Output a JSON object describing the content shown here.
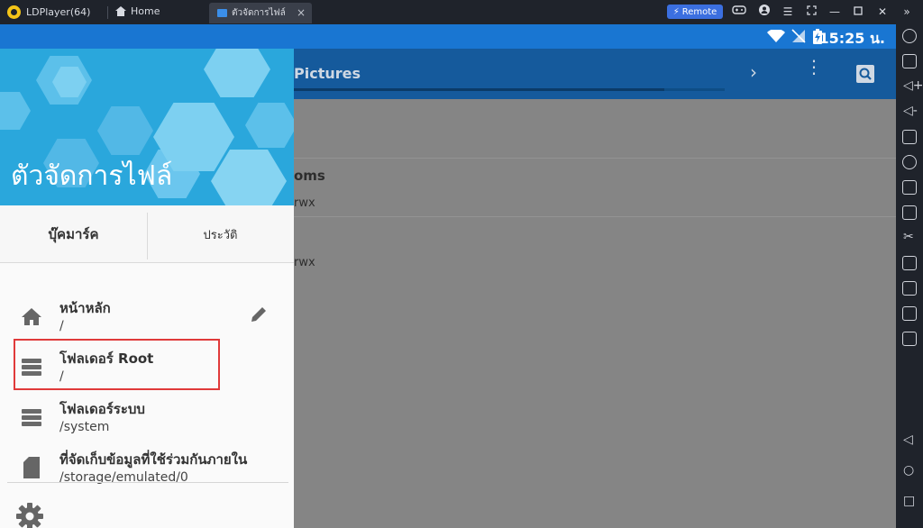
{
  "emulator": {
    "title": "LDPlayer(64)",
    "home_tab": "Home",
    "active_tab": "ตัวจัดการไฟล์",
    "remote_label": "Remote"
  },
  "statusbar": {
    "time": "15:25 น."
  },
  "appbar": {
    "path_title": "Pictures",
    "progress": 0.86
  },
  "content": {
    "rows": [
      {
        "name": "oms",
        "perm": "rwx"
      },
      {
        "name": "",
        "perm": "rwx"
      }
    ]
  },
  "drawer": {
    "header_title": "ตัวจัดการไฟล์",
    "tabs": [
      "บุ๊คมาร์ค",
      "ประวัติ"
    ],
    "items": [
      {
        "title": "หน้าหลัก",
        "path": "/",
        "icon": "home-icon"
      },
      {
        "title": "โฟลเดอร์ Root",
        "path": "/",
        "icon": "list-icon"
      },
      {
        "title": "โฟลเดอร์ระบบ",
        "path": "/system",
        "icon": "list-icon"
      },
      {
        "title": "ที่จัดเก็บข้อมูลที่ใช้ร่วมกันภายใน",
        "path": "/storage/emulated/0",
        "icon": "sd-card-icon"
      }
    ]
  },
  "colors": {
    "statusbar": "#1976d2",
    "appbar": "#155a9c",
    "drawer_header": "#2aa7dc",
    "highlight": "#e03a3a",
    "remote_button": "#3b6fe0"
  }
}
